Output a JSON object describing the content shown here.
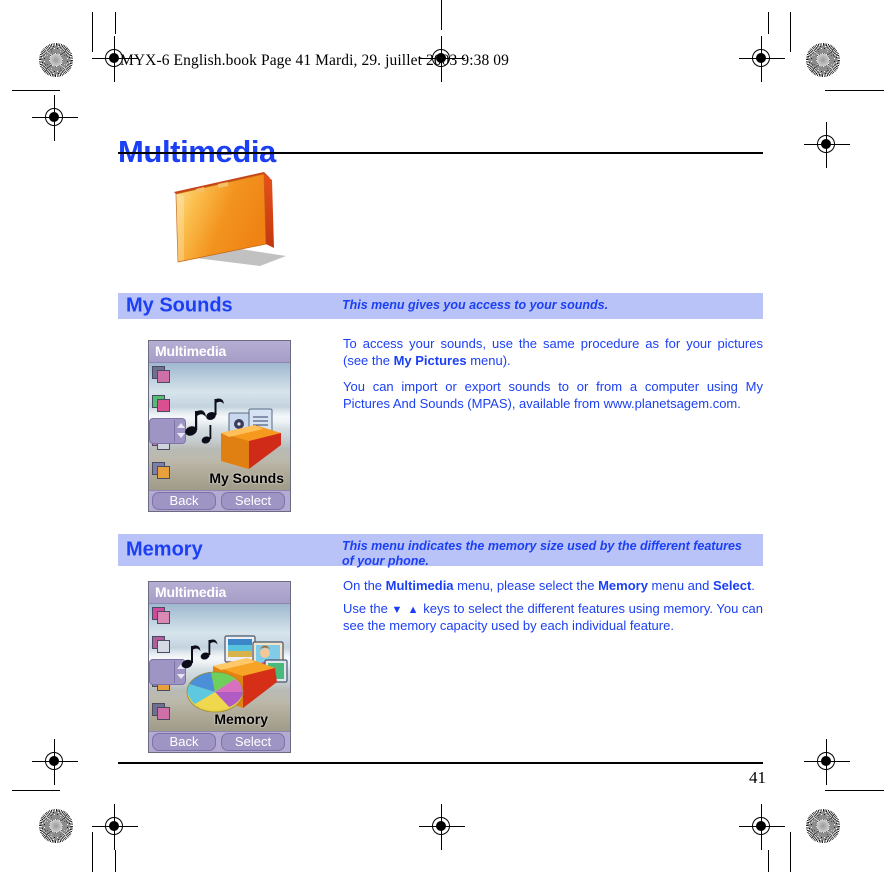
{
  "document": {
    "book_header": "MYX-6 English.book  Page 41  Mardi, 29. juillet 2003  9:38 09",
    "chapter_title": "Multimedia",
    "page_number": "41"
  },
  "sections": [
    {
      "title": "My Sounds",
      "description": "This menu gives you access to your sounds.",
      "paragraphs": [
        "To access your sounds, use the same procedure as for your pictures (see the My Pictures menu).",
        "You can import or export sounds to or from a computer using My Pictures And Sounds (MPAS), available from www.planetsagem.com."
      ],
      "phone": {
        "title": "Multimedia",
        "screen_label": "My Sounds",
        "softkey_left": "Back",
        "softkey_right": "Select"
      }
    },
    {
      "title": "Memory",
      "description": "This menu indicates the memory size used by the different features of your phone.",
      "paragraphs": [
        "On the Multimedia menu, please select the Memory menu and Select.",
        "Use the ▼ ▲ keys to select the different features using memory. You can see the memory capacity used by each individual feature."
      ],
      "phone": {
        "title": "Multimedia",
        "screen_label": "Memory",
        "softkey_left": "Back",
        "softkey_right": "Select"
      }
    }
  ],
  "text_runs": {
    "s1_p1_a": "To access your sounds, use the same procedure as for your pictures (see the ",
    "s1_p1_b": "My Pictures",
    "s1_p1_c": " menu).",
    "s1_p2": "You can import or export sounds to or from a computer using My Pictures And Sounds (MPAS), available from www.planetsagem.com.",
    "s2_p1_a": "On the ",
    "s2_p1_b": "Multimedia",
    "s2_p1_c": " menu, please select the ",
    "s2_p1_d": "Memory",
    "s2_p1_e": " menu and ",
    "s2_p1_f": "Select",
    "s2_p1_g": ".",
    "s2_p2_a": "Use the ",
    "s2_p2_arrows": "▼ ▲",
    "s2_p2_b": " keys to select the different features using memory. You can see the memory capacity used by each individual feature."
  },
  "colors": {
    "brand_blue": "#1b3ff5",
    "band_background": "#b9c3f7",
    "phone_titlebar": "#a79ec8",
    "folder_orange": "#f08a1e"
  },
  "icons": {
    "registration_mark": "registration-target-icon",
    "density_burst": "print-density-burst-icon",
    "folder": "folder-icon",
    "music_note": "music-note-icon",
    "scroll_up": "scroll-up-arrow-icon",
    "scroll_down": "scroll-down-arrow-icon"
  }
}
